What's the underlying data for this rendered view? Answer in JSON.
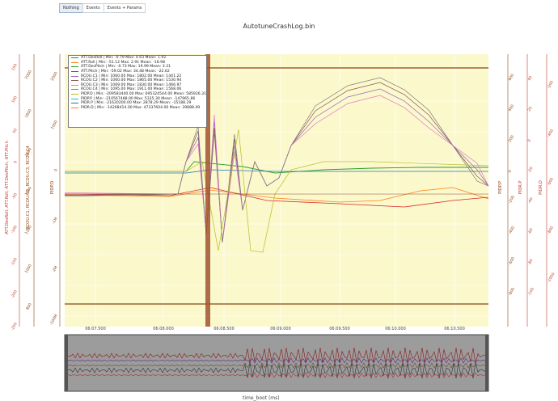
{
  "toolbar": {
    "buttons": [
      {
        "label": "Nothing",
        "active": true
      },
      {
        "label": "Events",
        "active": false
      },
      {
        "label": "Events + Params",
        "active": false
      }
    ]
  },
  "chart_data": {
    "type": "line",
    "title": "AutotuneCrashLog.bin",
    "xlabel": "time_boot (ms)",
    "x_ticks": [
      "06:07.500",
      "06:08.000",
      "06:08.500",
      "06:09.000",
      "06:09.500",
      "06:10.000",
      "06:10.500"
    ],
    "axes": {
      "att_left": {
        "label": "ATT.DesRoll, ATT.Roll, ATT.DesPitch, ATT.Pitch",
        "color": "#c0392b",
        "ticks": [
          "150",
          "100",
          "50",
          "0",
          "-50",
          "-100",
          "-150",
          "-200",
          "-250"
        ]
      },
      "rcou_left": {
        "label": "RCOU.C1, RCOU.C2, RCOU.C3, RCOU.C4",
        "color": "#8b4513",
        "ticks": [
          "2000",
          "1800",
          "1600",
          "1400",
          "1200",
          "1000",
          "800"
        ]
      },
      "pidp_left": {
        "label": "PIDP.D",
        "color": "#8b4513",
        "ticks": [
          "2000",
          "1000",
          "0",
          "-1M",
          "-2M",
          "-100M"
        ]
      },
      "pidp_right": {
        "label": "PIDP.P",
        "color": "#8b4513",
        "ticks": [
          "600",
          "400",
          "200",
          "0",
          "-200",
          "-400",
          "-600",
          "-800"
        ]
      },
      "pidr_p": {
        "label": "PIDR.P",
        "color": "#c0392b",
        "ticks": [
          "40",
          "20",
          "0",
          "-20",
          "-40",
          "-60",
          "-80",
          "-100"
        ]
      },
      "pidr_d": {
        "label": "PIDR.D",
        "color": "#c0392b",
        "ticks": [
          "-200",
          "-400",
          "-600",
          "-800",
          "-1000"
        ]
      }
    },
    "legend_position": "top-left",
    "series": [
      {
        "name": "ATT.DesRoll",
        "stats": "ATT.DesRoll | Min: -0.79    Max: 4.63    Mean: 1.92",
        "color": "#1f77b4"
      },
      {
        "name": "ATT.Roll",
        "stats": "ATT.Roll | Min: -51.12    Max: 2.91    Mean: -18.98",
        "color": "#ff7f0e"
      },
      {
        "name": "ATT.DesPitch",
        "stats": "ATT.DesPitch | Min: -0.73    Max: 19.99    Mean: 3.31",
        "color": "#2ca02c"
      },
      {
        "name": "ATT.Pitch",
        "stats": "ATT.Pitch | Min: -59.02    Max: 34.48    Mean: -22.62",
        "color": "#d62728"
      },
      {
        "name": "RCOU.C1",
        "stats": "RCOU.C1 | Min: 1060.00    Max: 1802.00    Mean: 1441.22",
        "color": "#9467bd"
      },
      {
        "name": "RCOU.C2",
        "stats": "RCOU.C2 | Min: 1060.00    Max: 1865.00    Mean: 1530.94",
        "color": "#8c564b"
      },
      {
        "name": "RCOU.C3",
        "stats": "RCOU.C3 | Min: 1069.00    Max: 1830.00    Mean: 1466.97",
        "color": "#e377c2"
      },
      {
        "name": "RCOU.C4",
        "stats": "RCOU.C4 | Min: 1095.00    Max: 1911.00    Mean: 1568.06",
        "color": "#7f7f7f"
      },
      {
        "name": "PIDP.D",
        "stats": "PIDP.D | Min: -209583440.00    Max: 695324544.00    Mean: 585926.31",
        "color": "#bcbd22"
      },
      {
        "name": "PIDP.P",
        "stats": "PIDP.P | Min: -210567488.00    Max: 5335.30    Mean: -147965.86",
        "color": "#17becf"
      },
      {
        "name": "PIDR.P",
        "stats": "PIDR.P | Min: -21620200.00    Max: 2878.29    Mean: -15188.29",
        "color": "#1f77b4"
      },
      {
        "name": "PIDR.D",
        "stats": "PIDR.D | Min: -14268414.00    Max: 47337604.00    Mean: 39888.49",
        "color": "#ff7f0e"
      }
    ]
  }
}
